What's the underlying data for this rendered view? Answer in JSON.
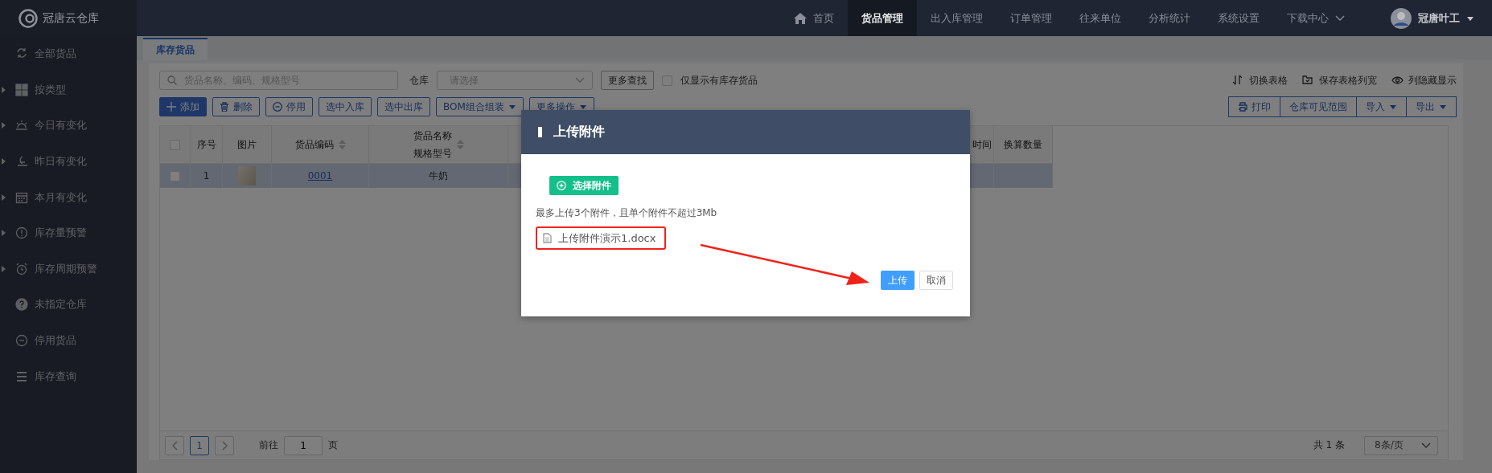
{
  "app": {
    "title": "冠唐云仓库"
  },
  "nav": [
    {
      "label": "首页",
      "selected": false,
      "kind": "home"
    },
    {
      "label": "货品管理",
      "selected": true,
      "kind": "plain"
    },
    {
      "label": "出入库管理",
      "selected": false,
      "kind": "plain"
    },
    {
      "label": "订单管理",
      "selected": false,
      "kind": "plain"
    },
    {
      "label": "往来单位",
      "selected": false,
      "kind": "plain"
    },
    {
      "label": "分析统计",
      "selected": false,
      "kind": "plain"
    },
    {
      "label": "系统设置",
      "selected": false,
      "kind": "plain"
    },
    {
      "label": "下载中心",
      "selected": false,
      "kind": "dropdown"
    }
  ],
  "user": {
    "name": "冠唐叶工"
  },
  "sidebar": {
    "items": [
      {
        "label": "全部货品",
        "expandable": false
      },
      {
        "label": "按类型",
        "expandable": true
      },
      {
        "label": "今日有变化",
        "expandable": true
      },
      {
        "label": "昨日有变化",
        "expandable": true
      },
      {
        "label": "本月有变化",
        "expandable": true
      },
      {
        "label": "库存量预警",
        "expandable": true
      },
      {
        "label": "库存周期预警",
        "expandable": true
      },
      {
        "label": "未指定仓库",
        "expandable": false
      },
      {
        "label": "停用货品",
        "expandable": false
      },
      {
        "label": "库存查询",
        "expandable": false
      }
    ]
  },
  "tabs": [
    {
      "label": "库存货品",
      "selected": true
    }
  ],
  "filters": {
    "search": {
      "placeholder": "货品名称、编码、规格型号"
    },
    "warehouse_label": "仓库",
    "warehouse": {
      "placeholder": "请选择"
    },
    "more_search": "更多查找",
    "in_stock_only": {
      "label": "仅显示有库存货品",
      "checked": false
    }
  },
  "table_tools": [
    {
      "label": "切换表格",
      "kind": "switch"
    },
    {
      "label": "保存表格列宽",
      "kind": "save"
    },
    {
      "label": "列隐藏显示",
      "kind": "eye"
    }
  ],
  "actions": [
    {
      "label": "添加",
      "kind": "add"
    },
    {
      "label": "删除",
      "kind": "delete"
    },
    {
      "label": "停用",
      "kind": "disable"
    },
    {
      "label": "选中入库",
      "kind": "plain"
    },
    {
      "label": "选中出库",
      "kind": "plain"
    },
    {
      "label": "BOM组合组装",
      "kind": "dropdown"
    },
    {
      "label": "更多操作",
      "kind": "dropdown"
    }
  ],
  "right_actions": [
    {
      "label": "打印",
      "kind": "print"
    },
    {
      "label": "仓库可见范围",
      "kind": "plain"
    },
    {
      "label": "导入",
      "kind": "dropdown"
    },
    {
      "label": "导出",
      "kind": "dropdown"
    }
  ],
  "table": {
    "header_checked": false,
    "columns": [
      {
        "label": "序号",
        "sortable": false
      },
      {
        "label": "图片",
        "sortable": false
      },
      {
        "label": "货品编码",
        "sortable": true
      },
      {
        "label": "货品名称",
        "sublabel": "规格型号",
        "sortable": true
      },
      {
        "label": "时间",
        "sortable": false
      },
      {
        "label": "换算数量",
        "sortable": false
      }
    ],
    "rows": [
      {
        "checked": false,
        "highlighted": true,
        "cells": [
          "1",
          "",
          "0001",
          "牛奶",
          "",
          ""
        ]
      }
    ]
  },
  "pagination": {
    "pages": [
      {
        "label": "1",
        "selected": true
      }
    ],
    "goto_label": "前往",
    "goto_value": "1",
    "page_suffix": "页",
    "total": "共 1 条",
    "page_size": "8条/页"
  },
  "dialog": {
    "title": "上传附件",
    "choose_button": "选择附件",
    "hint": "最多上传3个附件，且单个附件不超过3Mb",
    "files": [
      {
        "name": "上传附件演示1.docx",
        "highlighted": true
      }
    ],
    "buttons": [
      {
        "label": "上传",
        "kind": "primary"
      },
      {
        "label": "取消",
        "kind": "default"
      }
    ]
  }
}
